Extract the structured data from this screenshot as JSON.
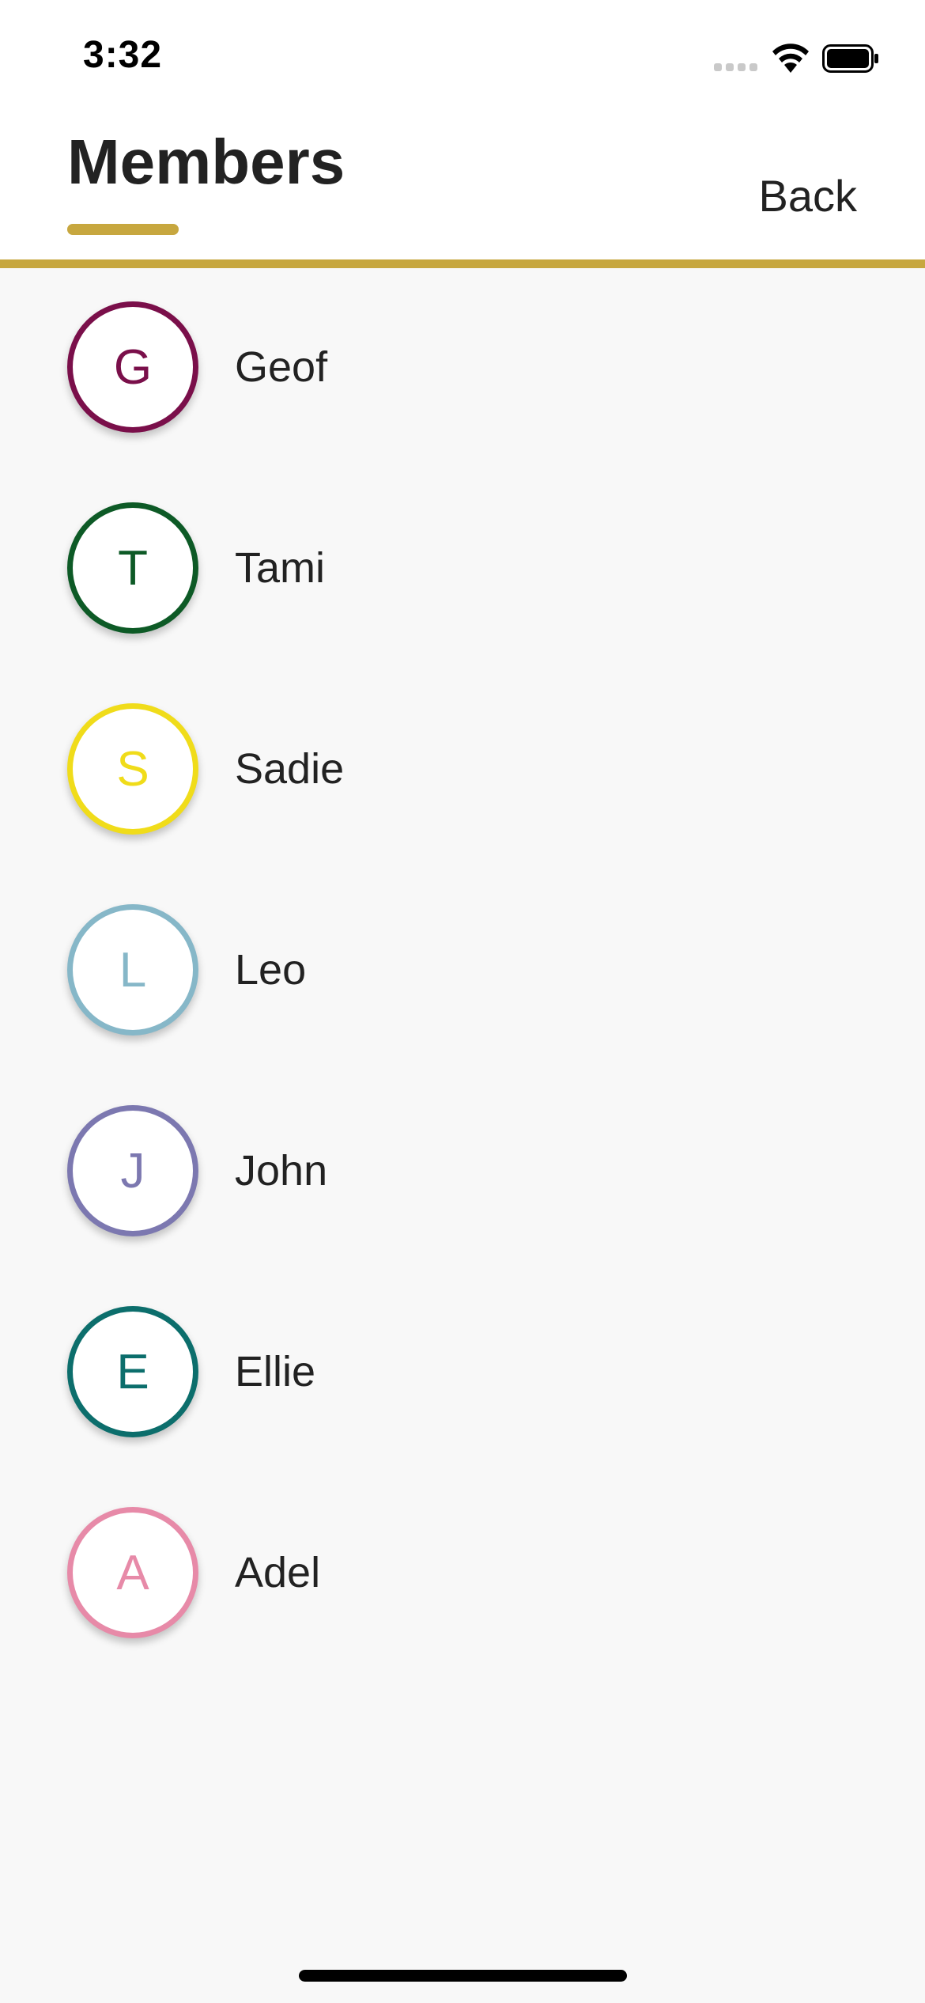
{
  "status_bar": {
    "time": "3:32"
  },
  "header": {
    "title": "Members",
    "back_label": "Back",
    "accent_color": "#c7a73f"
  },
  "members": [
    {
      "initial": "G",
      "name": "Geof",
      "color": "#7a0f4a"
    },
    {
      "initial": "T",
      "name": "Tami",
      "color": "#0d5a26"
    },
    {
      "initial": "S",
      "name": "Sadie",
      "color": "#f0dc1a"
    },
    {
      "initial": "L",
      "name": "Leo",
      "color": "#86b7c8"
    },
    {
      "initial": "J",
      "name": "John",
      "color": "#7c78b0"
    },
    {
      "initial": "E",
      "name": "Ellie",
      "color": "#0c6e6c"
    },
    {
      "initial": "A",
      "name": "Adel",
      "color": "#e78aa8"
    }
  ]
}
